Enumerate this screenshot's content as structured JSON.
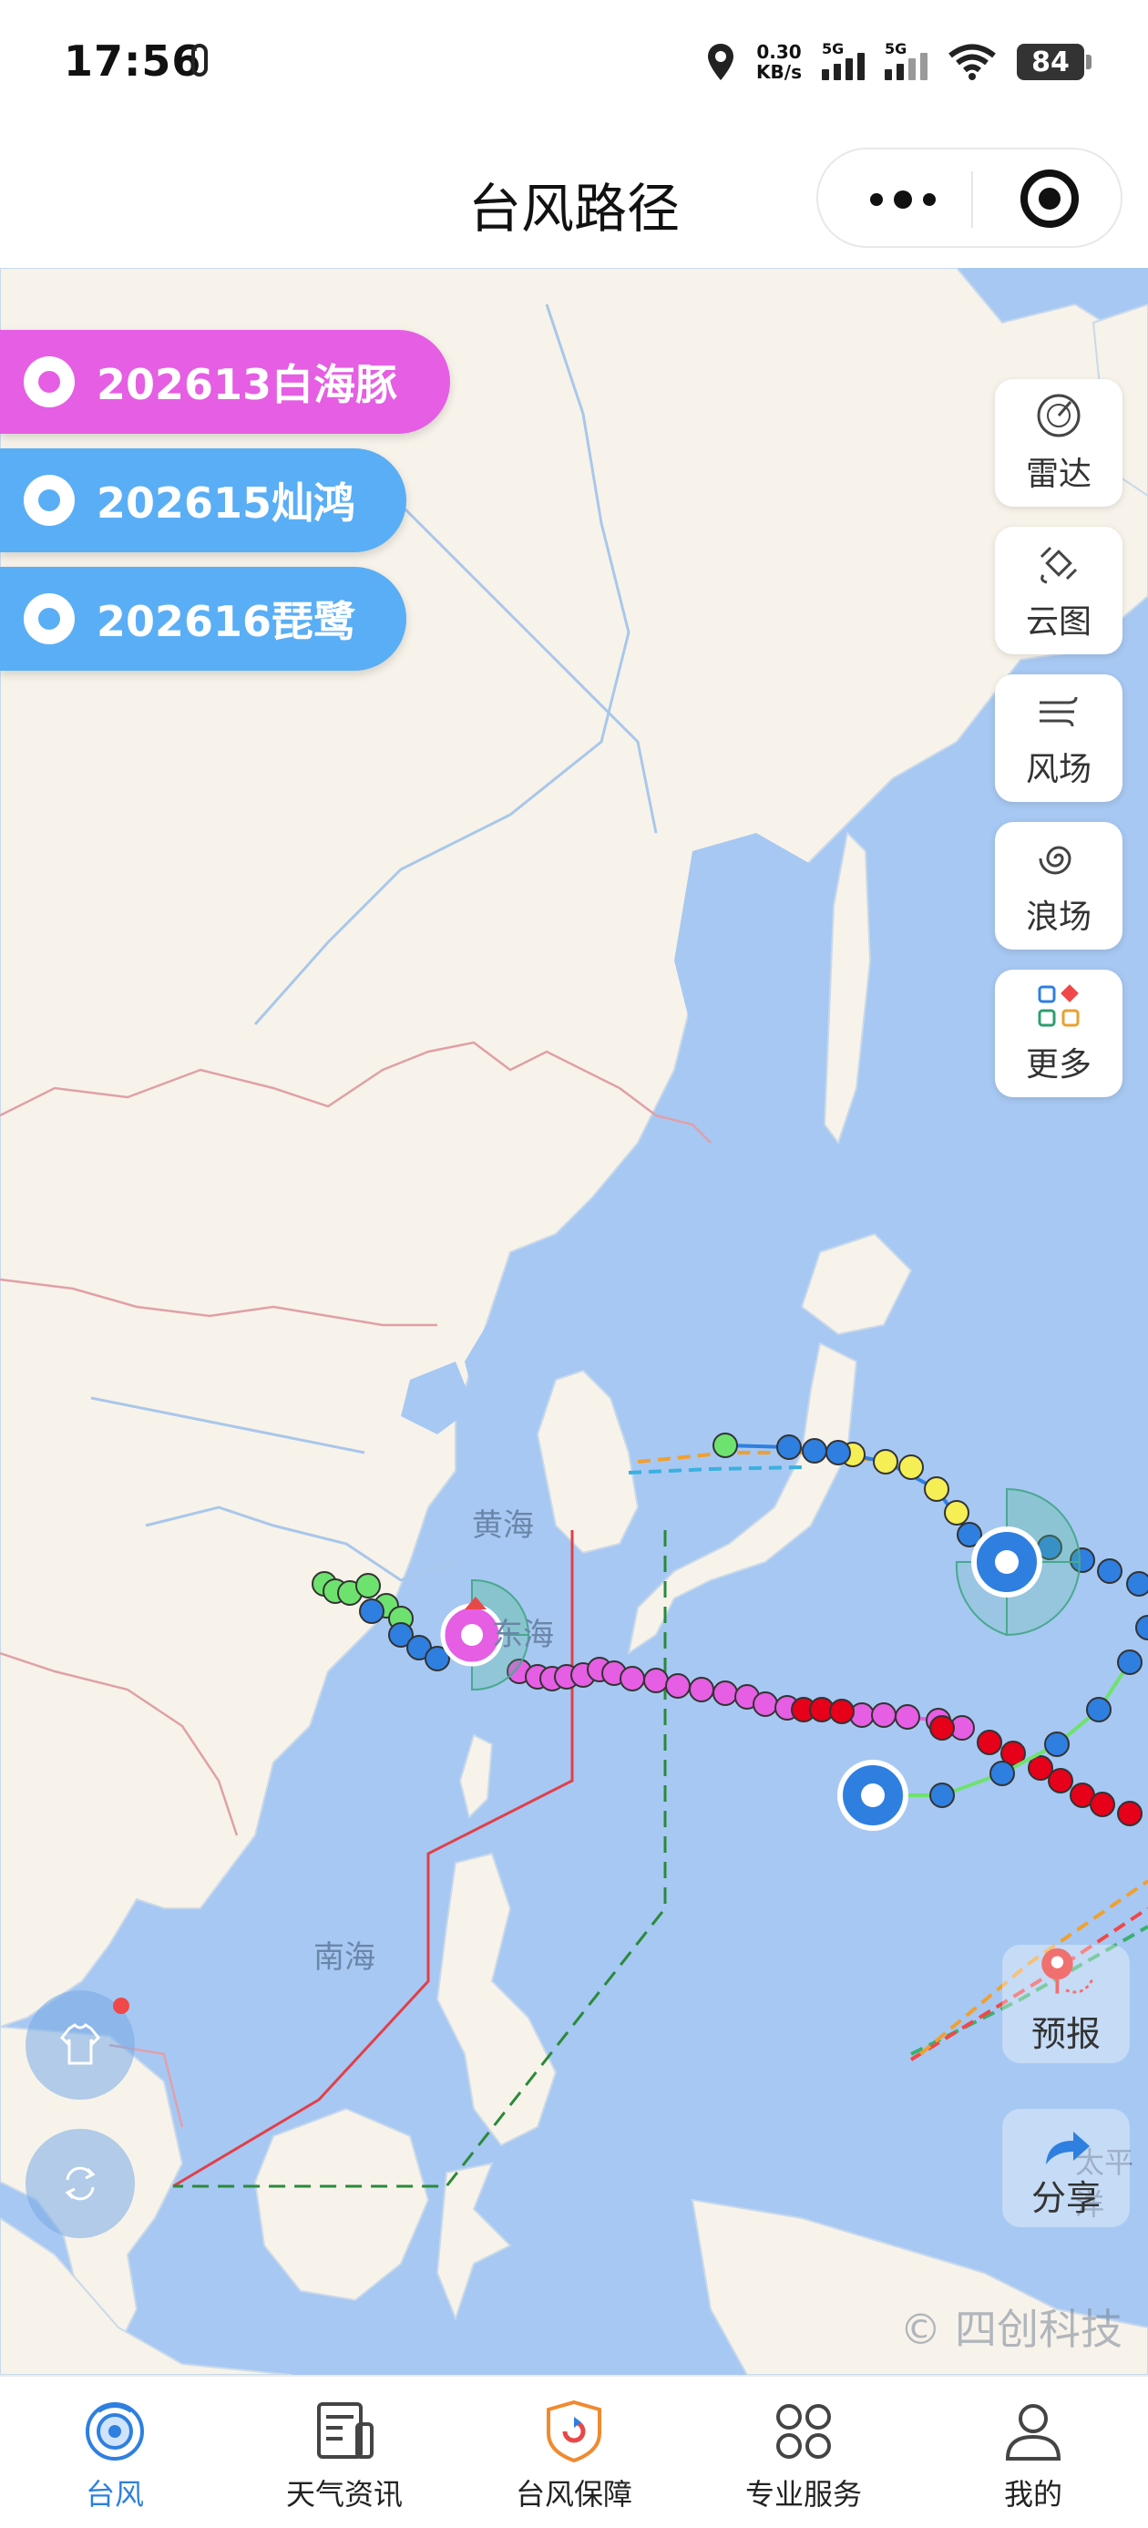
{
  "status_bar": {
    "time": "17:56",
    "net_speed_value": "0.30",
    "net_speed_unit": "KB/s",
    "sim1": "5G",
    "sim2": "5G",
    "battery": "84"
  },
  "header": {
    "title": "台风路径"
  },
  "typhoons": [
    {
      "label": "202613白海豚",
      "color": "#e55ee3"
    },
    {
      "label": "202615灿鸿",
      "color": "#5aaef5"
    },
    {
      "label": "202616琵鹭",
      "color": "#5aaef5"
    }
  ],
  "tools": {
    "radar": "雷达",
    "cloud": "云图",
    "wind": "风场",
    "wave": "浪场",
    "more": "更多",
    "forecast": "预报",
    "share": "分享"
  },
  "map_labels": {
    "yellow_sea": "黄海",
    "east_sea": "东海",
    "south_sea": "南海",
    "pacific": "太平洋"
  },
  "watermark": "© 四创科技",
  "tabs": [
    {
      "label": "台风"
    },
    {
      "label": "天气资讯"
    },
    {
      "label": "台风保障"
    },
    {
      "label": "专业服务"
    },
    {
      "label": "我的"
    }
  ],
  "colors": {
    "accent": "#2e7fe0",
    "ocean": "#a7c8f2",
    "land": "#f7f3ea",
    "track_pink": "#e55ee3",
    "track_red": "#e6001a",
    "track_blue": "#2e7fe0",
    "track_yellow": "#f5ee55",
    "track_green": "#6ee26e"
  }
}
